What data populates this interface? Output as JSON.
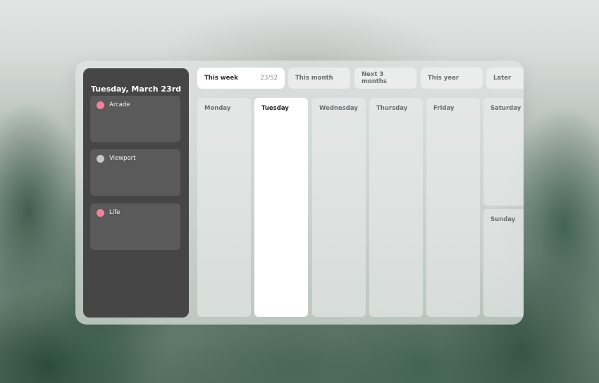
{
  "sidebar": {
    "date_title": "Tuesday, March 23rd",
    "projects": [
      {
        "label": "Arcade",
        "color": "#f0839b"
      },
      {
        "label": "Viewport",
        "color": "#c7c7c7"
      },
      {
        "label": "Life",
        "color": "#f0839b"
      }
    ]
  },
  "tabs": [
    {
      "label": "This week",
      "count": "23/52",
      "active": true
    },
    {
      "label": "This month",
      "active": false
    },
    {
      "label": "Next 3 months",
      "active": false
    },
    {
      "label": "This year",
      "active": false
    },
    {
      "label": "Later",
      "active": false
    }
  ],
  "days": [
    {
      "label": "Monday",
      "active": false
    },
    {
      "label": "Tuesday",
      "active": true
    },
    {
      "label": "Wednesday",
      "active": false
    },
    {
      "label": "Thursday",
      "active": false
    },
    {
      "label": "Friday",
      "active": false
    },
    {
      "label": "Saturday",
      "active": false
    },
    {
      "label": "Sunday",
      "active": false
    }
  ]
}
